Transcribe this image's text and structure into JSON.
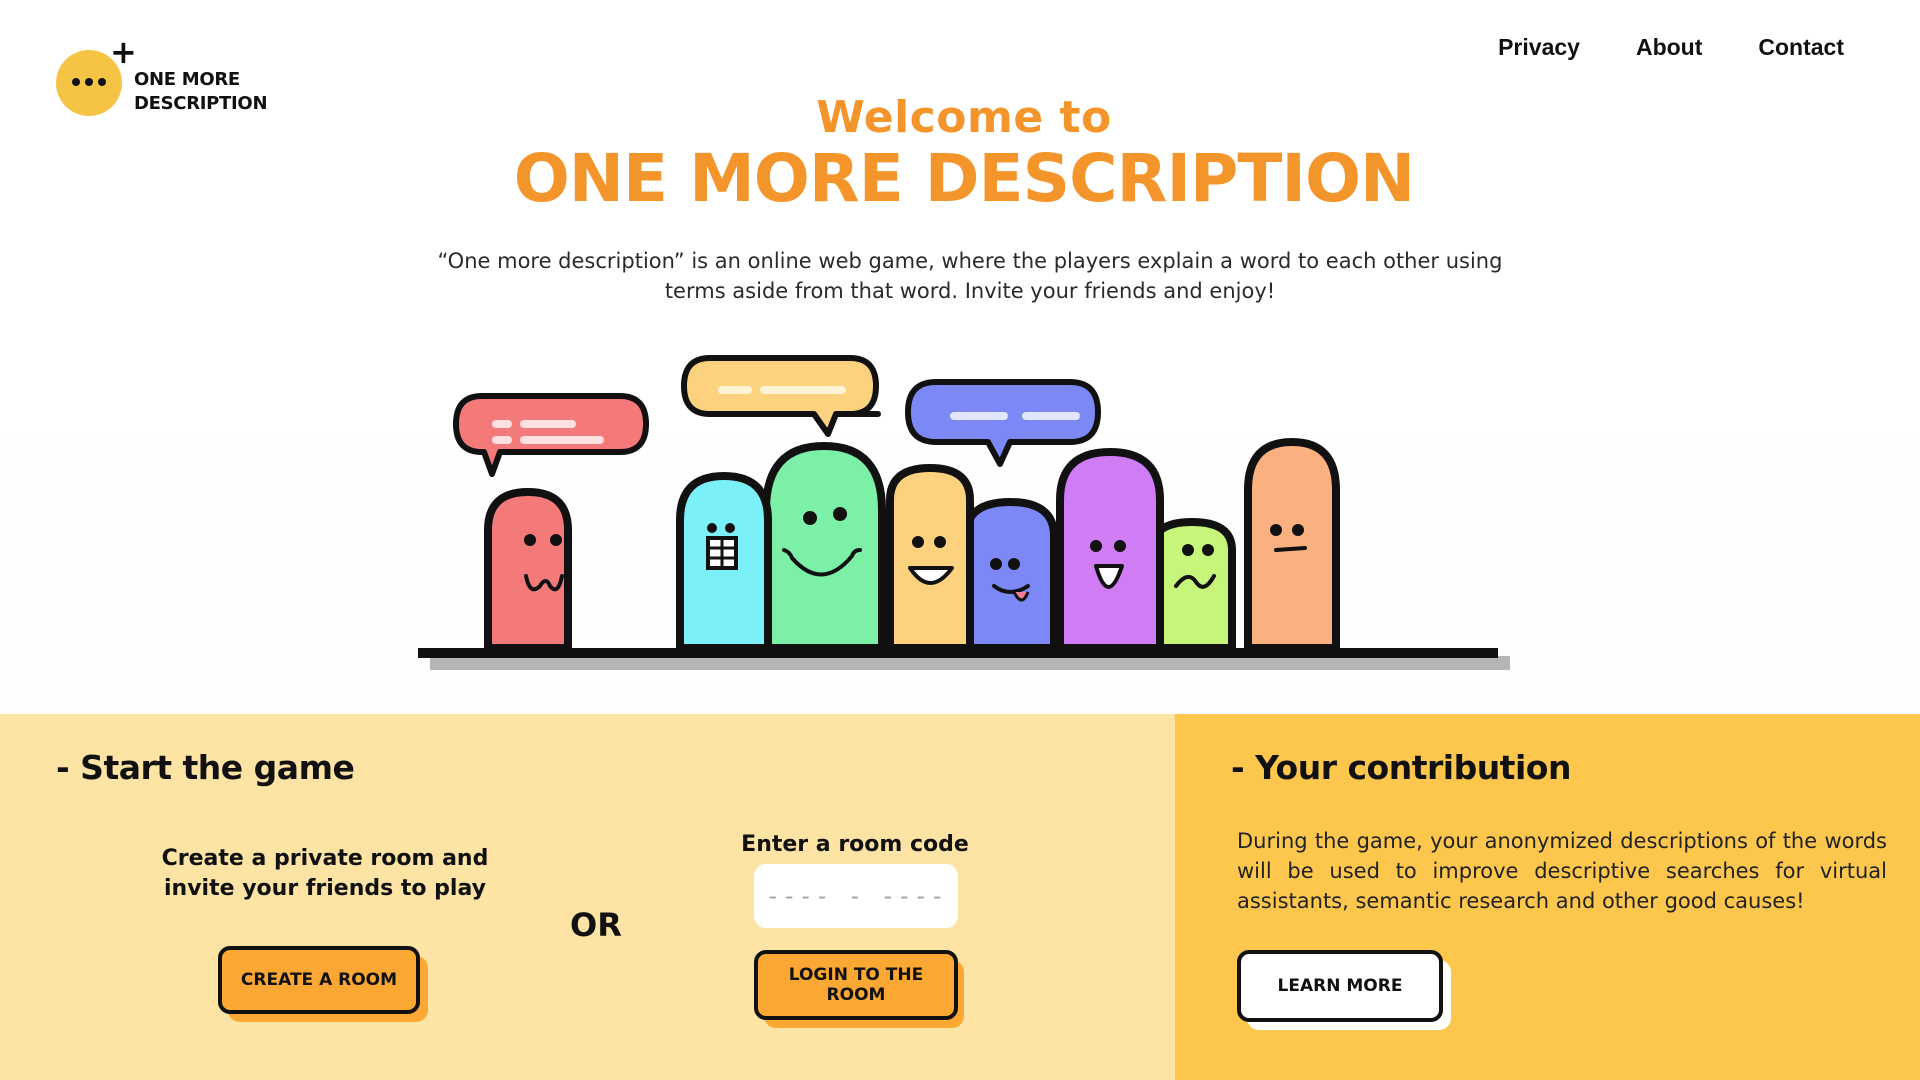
{
  "brand": {
    "logo_line1": "ONE MORE",
    "logo_line2": "DESCRIPTION",
    "color_primary": "#f4952b",
    "color_logo": "#f6c445"
  },
  "nav": {
    "items": [
      "Privacy",
      "About",
      "Contact"
    ]
  },
  "hero": {
    "welcome": "Welcome to",
    "title": "ONE MORE DESCRIPTION",
    "description": "“One more description” is an online web game, where the players explain a word to each other using terms aside from that word. Invite your friends and enjoy!"
  },
  "illustration": {
    "characters": [
      {
        "color": "#f47a7a",
        "face": "w-mouth"
      },
      {
        "color": "#7cf0f8",
        "face": "grid-mouth"
      },
      {
        "color": "#7df0a8",
        "face": "big-smile"
      },
      {
        "color": "#fdd27f",
        "face": "open-smile"
      },
      {
        "color": "#7b88f5",
        "face": "tongue"
      },
      {
        "color": "#d07cf5",
        "face": "laugh"
      },
      {
        "color": "#c6f57a",
        "face": "wavy-mouth"
      },
      {
        "color": "#fbb07f",
        "face": "flat-mouth"
      }
    ],
    "bubbles": [
      {
        "color": "#f47a7a"
      },
      {
        "color": "#fdd27f"
      },
      {
        "color": "#7b88f5"
      }
    ]
  },
  "start_game": {
    "title": "- Start the game",
    "create_line1": "Create a private room and",
    "create_line2": "invite your friends to play",
    "create_button": "CREATE A ROOM",
    "or": "OR",
    "room_code_label": "Enter a room code",
    "room_code_placeholder": "---- - ----",
    "login_button": "LOGIN TO THE ROOM",
    "panel_color": "#fde3a4",
    "button_color": "#fba734"
  },
  "contribution": {
    "title": "- Your contribution",
    "text": "During the game, your anonymized descriptions of the words will be used to improve descriptive searches for virtual assistants, semantic research and other good causes!",
    "learn_button": "LEARN MORE",
    "panel_color": "#fcc74c"
  }
}
